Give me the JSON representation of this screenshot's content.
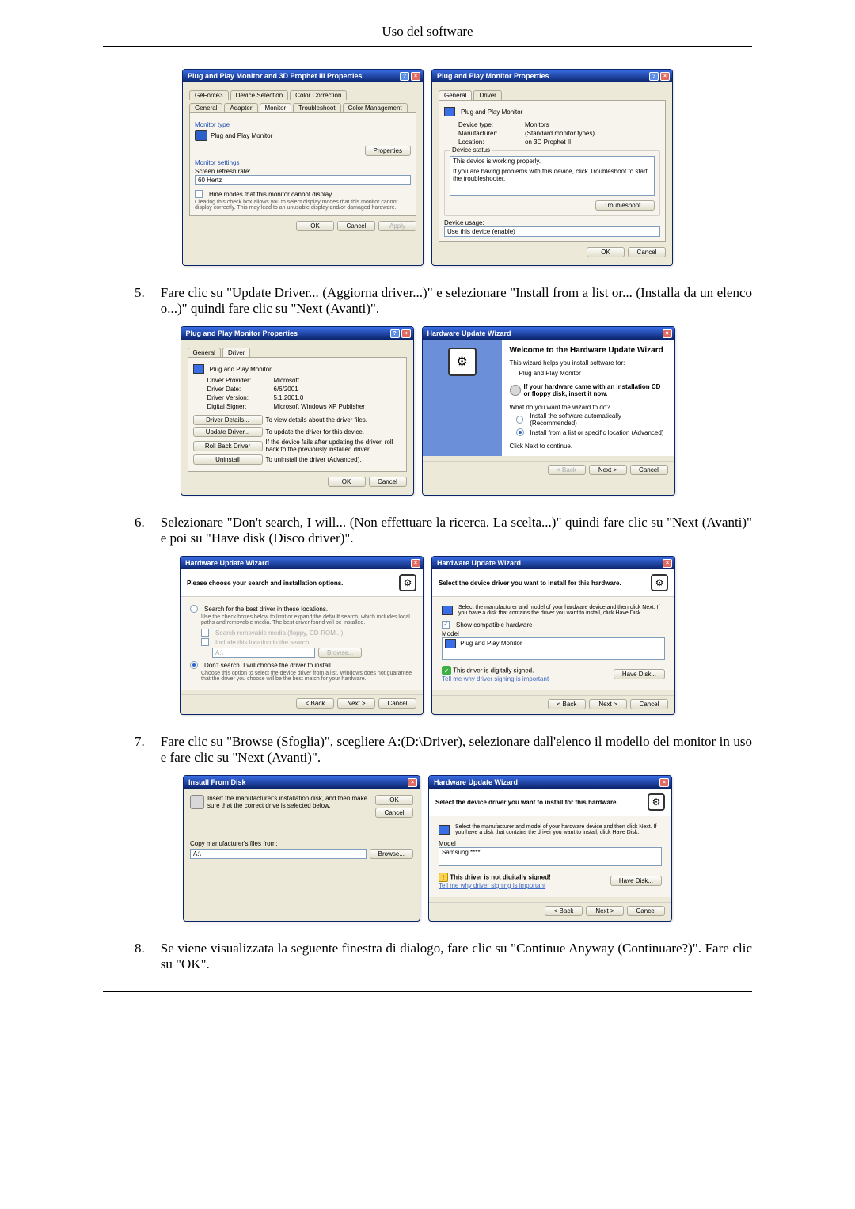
{
  "page_header": "Uso del software",
  "steps": {
    "s5": {
      "num": "5.",
      "text": "Fare clic su \"Update Driver... (Aggiorna driver...)\" e selezionare \"Install from a list or... (Installa da un elenco o...)\" quindi fare clic su \"Next (Avanti)\"."
    },
    "s6": {
      "num": "6.",
      "text": "Selezionare \"Don't search, I will... (Non effettuare la ricerca. La scelta...)\" quindi fare clic su \"Next (Avanti)\" e poi su \"Have disk (Disco driver)\"."
    },
    "s7": {
      "num": "7.",
      "text": "Fare clic su \"Browse (Sfoglia)\", scegliere A:(D:\\Driver), selezionare dall'elenco il modello del monitor in uso e fare clic su \"Next (Avanti)\"."
    },
    "s8": {
      "num": "8.",
      "text": "Se viene visualizzata la seguente finestra di dialogo, fare clic su \"Continue Anyway (Continuare?)\". Fare clic su \"OK\"."
    }
  },
  "common": {
    "ok": "OK",
    "cancel": "Cancel",
    "apply": "Apply",
    "back": "< Back",
    "next": "Next >",
    "browse": "Browse...",
    "have_disk": "Have Disk..."
  },
  "fig1_left": {
    "title": "Plug and Play Monitor and 3D Prophet III Properties",
    "tabs_row1": [
      "GeForce3",
      "Device Selection",
      "Color Correction"
    ],
    "tabs_row2": [
      "General",
      "Adapter",
      "Monitor",
      "Troubleshoot",
      "Color Management"
    ],
    "monitor_type": "Monitor type",
    "monitor_name": "Plug and Play Monitor",
    "properties": "Properties",
    "monitor_settings": "Monitor settings",
    "refresh_label": "Screen refresh rate:",
    "refresh_value": "60 Hertz",
    "hide_modes": "Hide modes that this monitor cannot display",
    "hide_modes_note": "Clearing this check box allows you to select display modes that this monitor cannot display correctly. This may lead to an unusable display and/or damaged hardware."
  },
  "fig1_right": {
    "title": "Plug and Play Monitor Properties",
    "tab_general": "General",
    "tab_driver": "Driver",
    "name": "Plug and Play Monitor",
    "rows": {
      "type_label": "Device type:",
      "type_val": "Monitors",
      "manu_label": "Manufacturer:",
      "manu_val": "(Standard monitor types)",
      "loc_label": "Location:",
      "loc_val": "on 3D Prophet III"
    },
    "status_title": "Device status",
    "status_line1": "This device is working properly.",
    "status_line2": "If you are having problems with this device, click Troubleshoot to start the troubleshooter.",
    "troubleshoot": "Troubleshoot...",
    "usage_label": "Device usage:",
    "usage_value": "Use this device (enable)"
  },
  "fig2_left": {
    "title": "Plug and Play Monitor Properties",
    "tab_general": "General",
    "tab_driver": "Driver",
    "name": "Plug and Play Monitor",
    "rows": {
      "prov_label": "Driver Provider:",
      "prov_val": "Microsoft",
      "date_label": "Driver Date:",
      "date_val": "6/6/2001",
      "ver_label": "Driver Version:",
      "ver_val": "5.1.2001.0",
      "sign_label": "Digital Signer:",
      "sign_val": "Microsoft Windows XP Publisher"
    },
    "b1": "Driver Details...",
    "b1d": "To view details about the driver files.",
    "b2": "Update Driver...",
    "b2d": "To update the driver for this device.",
    "b3": "Roll Back Driver",
    "b3d": "If the device fails after updating the driver, roll back to the previously installed driver.",
    "b4": "Uninstall",
    "b4d": "To uninstall the driver (Advanced)."
  },
  "fig2_right": {
    "title": "Hardware Update Wizard",
    "welcome": "Welcome to the Hardware Update Wizard",
    "intro": "This wizard helps you install software for:",
    "device": "Plug and Play Monitor",
    "cd_note": "If your hardware came with an installation CD or floppy disk, insert it now.",
    "question": "What do you want the wizard to do?",
    "opt1": "Install the software automatically (Recommended)",
    "opt2": "Install from a list or specific location (Advanced)",
    "cont": "Click Next to continue."
  },
  "fig3_left": {
    "title": "Hardware Update Wizard",
    "header": "Please choose your search and installation options.",
    "opt_search": "Search for the best driver in these locations.",
    "search_note": "Use the check boxes below to limit or expand the default search, which includes local paths and removable media. The best driver found will be installed.",
    "chk1": "Search removable media (floppy, CD-ROM...)",
    "chk2": "Include this location in the search:",
    "path": "A:\\",
    "opt_dont": "Don't search. I will choose the driver to install.",
    "dont_note": "Choose this option to select the device driver from a list. Windows does not guarantee that the driver you choose will be the best match for your hardware."
  },
  "fig3_right": {
    "title": "Hardware Update Wizard",
    "header": "Select the device driver you want to install for this hardware.",
    "intro": "Select the manufacturer and model of your hardware device and then click Next. If you have a disk that contains the driver you want to install, click Have Disk.",
    "show_compat": "Show compatible hardware",
    "model_label": "Model",
    "model_value": "Plug and Play Monitor",
    "signed": "This driver is digitally signed.",
    "tell_me": "Tell me why driver signing is important"
  },
  "fig4_left": {
    "title": "Install From Disk",
    "msg": "Insert the manufacturer's installation disk, and then make sure that the correct drive is selected below.",
    "copy_label": "Copy manufacturer's files from:",
    "path_val": "A:\\"
  },
  "fig4_right": {
    "title": "Hardware Update Wizard",
    "header": "Select the device driver you want to install for this hardware.",
    "intro": "Select the manufacturer and model of your hardware device and then click Next. If you have a disk that contains the driver you want to install, click Have Disk.",
    "model_label": "Model",
    "model_value": "Samsung ****",
    "not_signed": "This driver is not digitally signed!",
    "tell_me": "Tell me why driver signing is important"
  }
}
